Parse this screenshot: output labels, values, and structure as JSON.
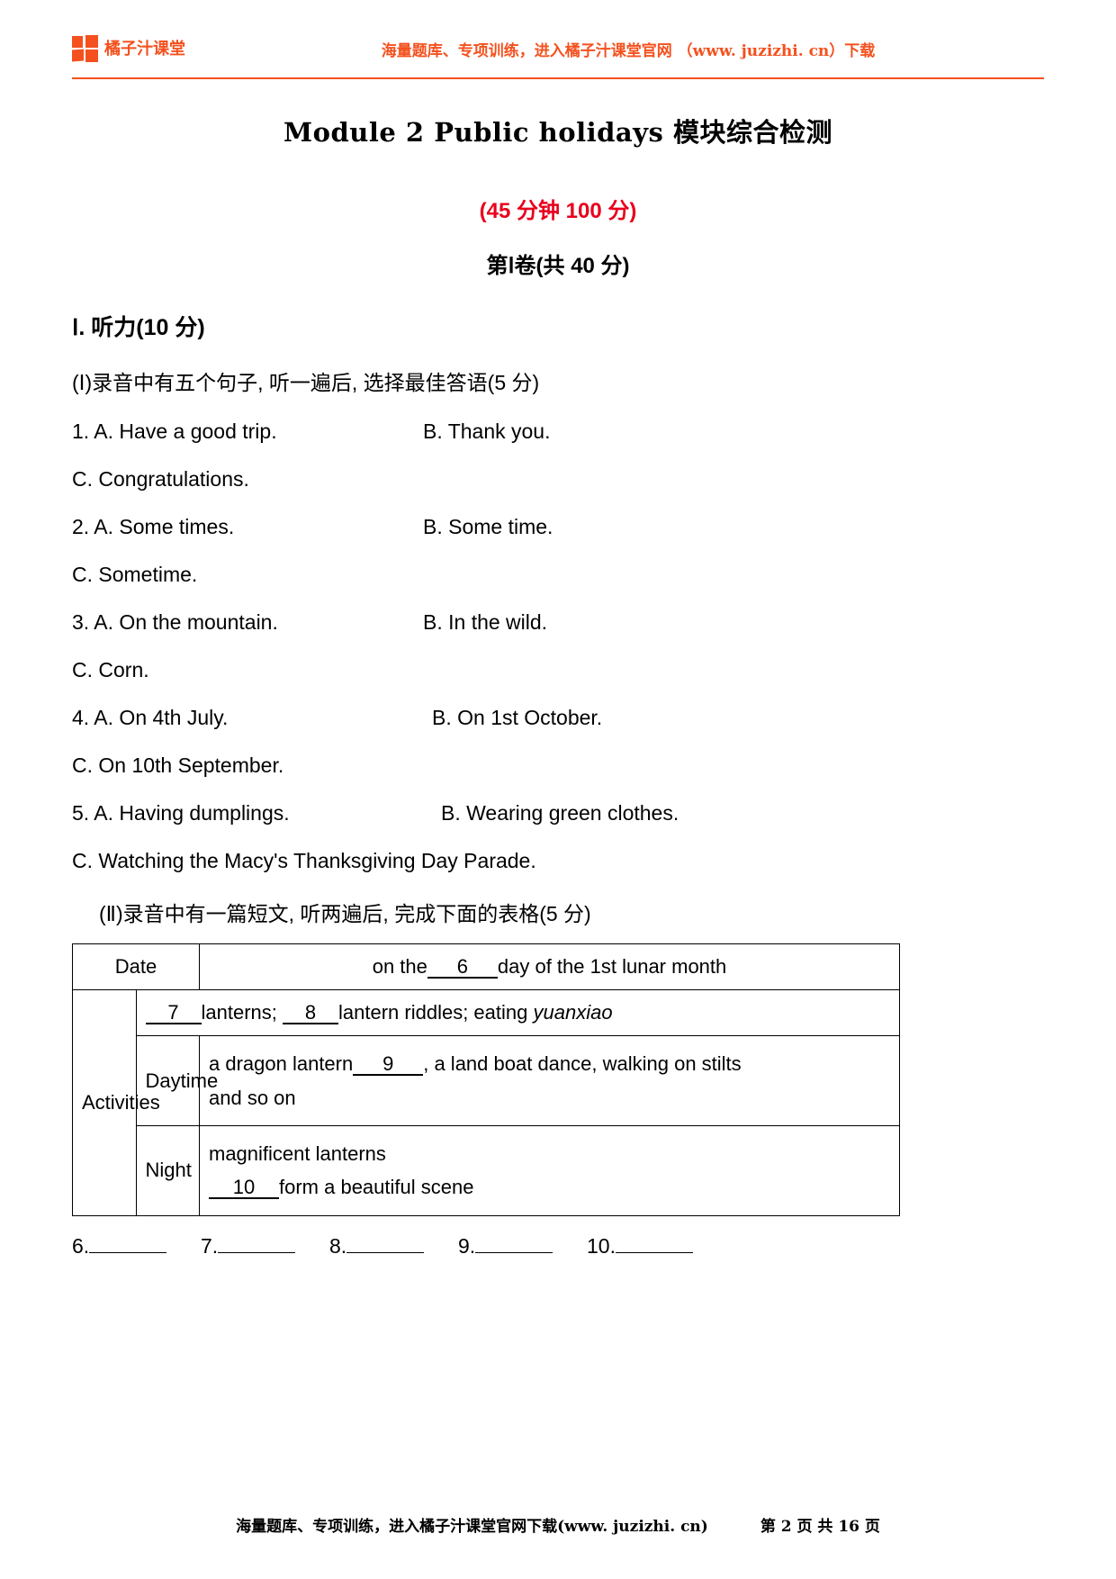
{
  "header": {
    "logo_text": "橘子汁课堂",
    "logo_icon": "four-squares-logo",
    "tagline": "海量题库、专项训练，进入橘子汁课堂官网 （www. juzizhi. cn）下载",
    "brand_color": "#F4511E"
  },
  "title": "Module 2 Public holidays 模块综合检测",
  "score_line": "(45 分钟   100 分)",
  "score_color": "#E8001C",
  "paper_line": "第Ⅰ卷(共 40 分)",
  "section": {
    "heading": "Ⅰ. 听力(10 分)",
    "part1_instruction": "(Ⅰ)录音中有五个句子, 听一遍后, 选择最佳答语(5 分)",
    "part2_instruction": "(Ⅱ)录音中有一篇短文, 听两遍后, 完成下面的表格(5 分)"
  },
  "questions": [
    {
      "a": "1. A. Have a good trip.",
      "b": "B. Thank you.",
      "c": "C. Congratulations."
    },
    {
      "a": "2. A. Some times.",
      "b": "B. Some time.",
      "c": "C. Sometime."
    },
    {
      "a": "3. A. On the mountain.",
      "b": "B. In the wild.",
      "c": "C. Corn."
    },
    {
      "a": "4. A. On 4th July.",
      "b": "B. On 1st October.",
      "c": "C. On 10th September."
    },
    {
      "a": "5. A. Having dumplings.",
      "b": "B. Wearing green clothes.",
      "c": "C. Watching the Macy's Thanksgiving Day Parade."
    }
  ],
  "table": {
    "date_label": "Date",
    "date_text_before": "on the",
    "date_blank": "6",
    "date_text_after": "day of the 1st lunar month",
    "activities_label": "Activities",
    "row_general": {
      "blank1": "7",
      "text1": "lanterns;",
      "blank2": "8",
      "text2": "lantern riddles; eating",
      "italic": "yuanxiao"
    },
    "daytime_label": "Daytime",
    "daytime": {
      "text_before": "a dragon lantern",
      "blank": "9",
      "text_after": ", a land boat dance, walking on stilts",
      "line2": "and so on"
    },
    "night_label": "Night",
    "night": {
      "line1": "magnificent lanterns",
      "blank": "10",
      "text_after": "form a beautiful scene"
    }
  },
  "answers": [
    {
      "num": "6."
    },
    {
      "num": "7."
    },
    {
      "num": "8."
    },
    {
      "num": "9."
    },
    {
      "num": "10."
    }
  ],
  "footer": {
    "main": "海量题库、专项训练，进入橘子汁课堂官网下载(www. juzizhi. cn)",
    "page": "第 2 页 共 16 页"
  }
}
